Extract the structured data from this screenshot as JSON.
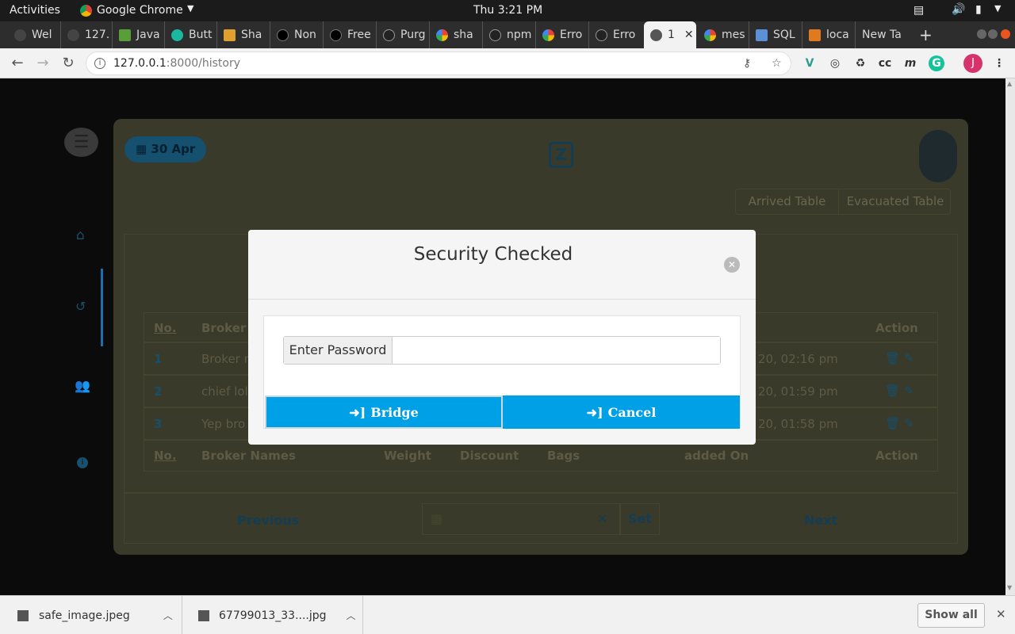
{
  "system_bar": {
    "activities": "Activities",
    "app_name": "Google Chrome",
    "clock": "Thu  3:21 PM"
  },
  "tabs": [
    {
      "label": "Wel",
      "icon": "blank-favicon"
    },
    {
      "label": "127.",
      "icon": "blank-favicon"
    },
    {
      "label": "Java",
      "icon": "green-favicon"
    },
    {
      "label": "Butt",
      "icon": "teal-favicon"
    },
    {
      "label": "Sha",
      "icon": "puzzle-favicon"
    },
    {
      "label": "Non",
      "icon": "dark-favicon"
    },
    {
      "label": "Free",
      "icon": "dark-favicon"
    },
    {
      "label": "Purg",
      "icon": "github-favicon"
    },
    {
      "label": "sha",
      "icon": "google-favicon"
    },
    {
      "label": "npm",
      "icon": "github-favicon"
    },
    {
      "label": "Erro",
      "icon": "google-favicon"
    },
    {
      "label": "Erro",
      "icon": "github-favicon"
    },
    {
      "label": "1",
      "icon": "globe-favicon"
    },
    {
      "label": "mes",
      "icon": "google-favicon"
    },
    {
      "label": "SQL",
      "icon": "sql-favicon"
    },
    {
      "label": "loca",
      "icon": "pma-favicon"
    },
    {
      "label": "New Ta",
      "icon": "none"
    }
  ],
  "address": {
    "host": "127.0.0.1",
    "path": ":8000/history"
  },
  "profile_initial": "J",
  "app": {
    "date_badge": "30 Apr",
    "tabs": [
      "Arrived Table",
      "Evacuated Table"
    ],
    "table_headers": [
      "No.",
      "Broker Names",
      "Weight",
      "Discount",
      "Bags",
      "added On",
      "Action"
    ],
    "partial_header": "Broker N",
    "rows": [
      {
        "no": "1",
        "name": "Broker n",
        "added": "20, 02:16 pm"
      },
      {
        "no": "2",
        "name": "chief lol",
        "added": "20, 01:59 pm"
      },
      {
        "no": "3",
        "name": "Yep bro",
        "added": "20, 01:58 pm"
      }
    ],
    "pagination": {
      "previous": "Previous",
      "set": "Set",
      "next": "Next"
    }
  },
  "modal": {
    "title": "Security Checked",
    "password_label": "Enter Password",
    "password_value": "",
    "bridge_button": "Bridge",
    "cancel_button": "Cancel"
  },
  "downloads": {
    "items": [
      "safe_image.jpeg",
      "67799013_33....jpg"
    ],
    "show_all": "Show all"
  },
  "colors": {
    "accent": "#00a0e6",
    "card_bg": "#3a3a2a"
  }
}
